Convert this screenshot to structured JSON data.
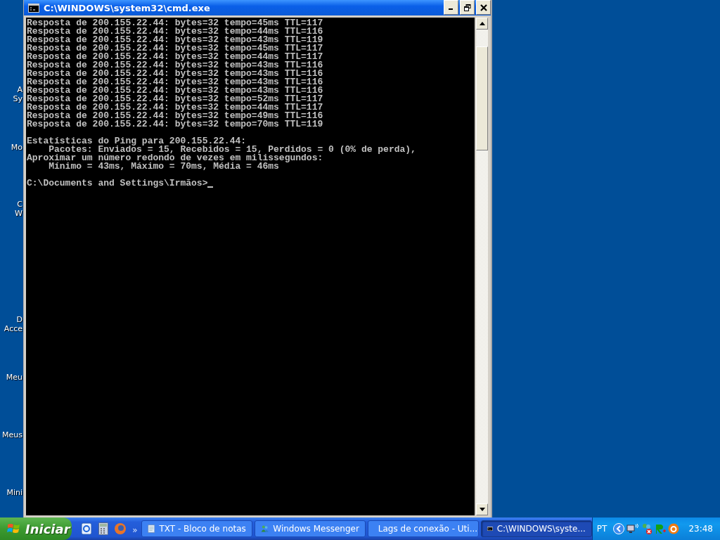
{
  "desktop_icons": [
    {
      "lines": [
        "A",
        "Sy"
      ]
    },
    {
      "lines": [
        "Mo"
      ]
    },
    {
      "lines": [
        "C",
        "W"
      ]
    },
    {
      "lines": [
        "D",
        "Acce"
      ]
    },
    {
      "lines": [
        "Meu"
      ]
    },
    {
      "lines": [
        "Meus"
      ]
    },
    {
      "lines": [
        "Mini"
      ]
    }
  ],
  "window": {
    "title": "C:\\WINDOWS\\system32\\cmd.exe"
  },
  "console": {
    "replies": [
      "Resposta de 200.155.22.44: bytes=32 tempo=45ms TTL=117",
      "Resposta de 200.155.22.44: bytes=32 tempo=44ms TTL=116",
      "Resposta de 200.155.22.44: bytes=32 tempo=43ms TTL=119",
      "Resposta de 200.155.22.44: bytes=32 tempo=45ms TTL=117",
      "Resposta de 200.155.22.44: bytes=32 tempo=44ms TTL=117",
      "Resposta de 200.155.22.44: bytes=32 tempo=43ms TTL=116",
      "Resposta de 200.155.22.44: bytes=32 tempo=43ms TTL=116",
      "Resposta de 200.155.22.44: bytes=32 tempo=43ms TTL=116",
      "Resposta de 200.155.22.44: bytes=32 tempo=43ms TTL=116",
      "Resposta de 200.155.22.44: bytes=32 tempo=52ms TTL=117",
      "Resposta de 200.155.22.44: bytes=32 tempo=44ms TTL=117",
      "Resposta de 200.155.22.44: bytes=32 tempo=49ms TTL=116",
      "Resposta de 200.155.22.44: bytes=32 tempo=70ms TTL=119"
    ],
    "statistics": [
      "Estatísticas do Ping para 200.155.22.44:",
      "    Pacotes: Enviados = 15, Recebidos = 15, Perdidos = 0 (0% de perda),",
      "Aproximar um número redondo de vezes em milissegundos:",
      "    Mínimo = 43ms, Máximo = 70ms, Média = 46ms"
    ],
    "prompt": "C:\\Documents and Settings\\Irmãos>"
  },
  "taskbar": {
    "start": "Iniciar",
    "quick_launch": [
      {
        "kind": "ie"
      },
      {
        "kind": "calculator"
      },
      {
        "kind": "firefox"
      }
    ],
    "overflow": "»",
    "tasks": [
      {
        "kind": "notepad",
        "label": "TXT - Bloco de notas",
        "selected": false
      },
      {
        "kind": "messenger",
        "label": "Windows Messenger",
        "selected": false
      },
      {
        "kind": "firefox",
        "label": "Lags de conexão - Uti...",
        "selected": false
      },
      {
        "kind": "console",
        "label": "C:\\WINDOWS\\syste...",
        "selected": true
      }
    ],
    "language": "PT",
    "clock": "23:48"
  }
}
